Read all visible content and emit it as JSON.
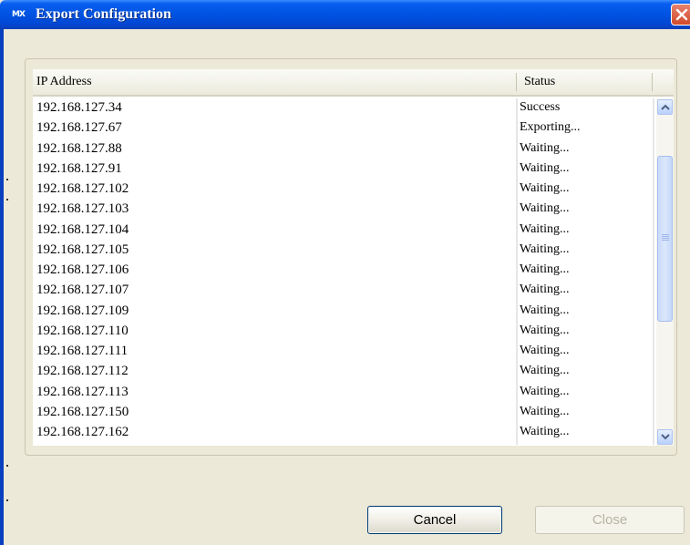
{
  "window": {
    "title": "Export Configuration",
    "app_icon_text": "MX"
  },
  "table": {
    "columns": {
      "ip": "IP Address",
      "status": "Status"
    },
    "rows": [
      {
        "ip": "192.168.127.34",
        "status": "Success"
      },
      {
        "ip": "192.168.127.67",
        "status": "Exporting..."
      },
      {
        "ip": "192.168.127.88",
        "status": "Waiting..."
      },
      {
        "ip": "192.168.127.91",
        "status": "Waiting..."
      },
      {
        "ip": "192.168.127.102",
        "status": "Waiting..."
      },
      {
        "ip": "192.168.127.103",
        "status": "Waiting..."
      },
      {
        "ip": "192.168.127.104",
        "status": "Waiting..."
      },
      {
        "ip": "192.168.127.105",
        "status": "Waiting..."
      },
      {
        "ip": "192.168.127.106",
        "status": "Waiting..."
      },
      {
        "ip": "192.168.127.107",
        "status": "Waiting..."
      },
      {
        "ip": "192.168.127.109",
        "status": "Waiting..."
      },
      {
        "ip": "192.168.127.110",
        "status": "Waiting..."
      },
      {
        "ip": "192.168.127.111",
        "status": "Waiting..."
      },
      {
        "ip": "192.168.127.112",
        "status": "Waiting..."
      },
      {
        "ip": "192.168.127.113",
        "status": "Waiting..."
      },
      {
        "ip": "192.168.127.150",
        "status": "Waiting..."
      },
      {
        "ip": "192.168.127.162",
        "status": "Waiting..."
      }
    ]
  },
  "buttons": {
    "cancel": "Cancel",
    "close": "Close"
  },
  "icons": {
    "close": "close-icon",
    "scroll_up": "chevron-up-icon",
    "scroll_down": "chevron-down-icon"
  },
  "colors": {
    "titlebar": "#0054e3",
    "close_button": "#d24a2a",
    "dialog_bg": "#ece9d8"
  }
}
